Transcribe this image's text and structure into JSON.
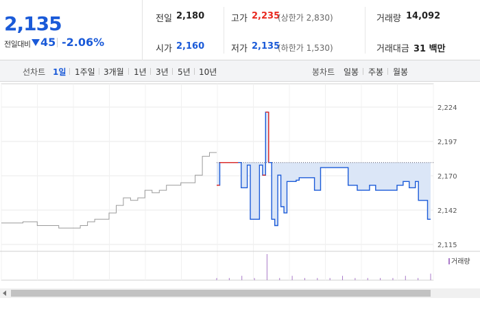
{
  "summary": {
    "current_price": "2,135",
    "change_label": "전일대비",
    "change_amount": "45",
    "change_percent": "-2.06%",
    "prev_close_label": "전일",
    "prev_close": "2,180",
    "open_label": "시가",
    "open": "2,160",
    "high_label": "고가",
    "high": "2,235",
    "upper_limit": "(상한가 2,830)",
    "low_label": "저가",
    "low": "2,135",
    "lower_limit": "(하한가 1,530)",
    "volume_label": "거래량",
    "volume": "14,092",
    "amount_label": "거래대금",
    "amount": "31 백만"
  },
  "line_tabs": {
    "heading": "선차트",
    "items": [
      "1일",
      "1주일",
      "3개월",
      "1년",
      "3년",
      "5년",
      "10년"
    ],
    "active": "1일"
  },
  "candle_tabs": {
    "heading": "봉차트",
    "items": [
      "일봉",
      "주봉",
      "월봉"
    ]
  },
  "chart_data": {
    "type": "line",
    "y_ticks": [
      "2,224",
      "2,197",
      "2,170",
      "2,142",
      "2,115"
    ],
    "ylim": [
      2115,
      2224
    ],
    "reference_price": 2180,
    "previous_day_series": [
      2132,
      2132,
      2132,
      2133,
      2133,
      2130,
      2130,
      2130,
      2128,
      2128,
      2128,
      2130,
      2133,
      2135,
      2135,
      2140,
      2146,
      2152,
      2150,
      2152,
      2158,
      2156,
      2158,
      2162,
      2162,
      2164,
      2164,
      2170,
      2185,
      2188,
      2188
    ],
    "today_series": [
      2162,
      2180,
      2180,
      2180,
      2180,
      2180,
      2180,
      2180,
      2160,
      2160,
      2178,
      2135,
      2135,
      2135,
      2178,
      2170,
      2220,
      2180,
      2135,
      2130,
      2170,
      2145,
      2140,
      2165,
      2165,
      2165,
      2166,
      2168,
      2168,
      2168,
      2168,
      2168,
      2158,
      2158,
      2176,
      2176,
      2176,
      2176,
      2176,
      2176,
      2176,
      2176,
      2176,
      2162,
      2162,
      2162,
      2158,
      2158,
      2158,
      2158,
      2162,
      2162,
      2158,
      2158,
      2158,
      2158,
      2158,
      2158,
      2158,
      2162,
      2162,
      2165,
      2165,
      2160,
      2160,
      2165,
      2150,
      2150,
      2150,
      2135,
      2135
    ],
    "volume_spikes": [
      1,
      1,
      2,
      1,
      12,
      1,
      2,
      1,
      1,
      1,
      2,
      1,
      1,
      1,
      1,
      2,
      1,
      3
    ],
    "legend": "거래량",
    "colors": {
      "up": "#e8281e",
      "down": "#1a5ad8",
      "prev": "#9a9a9a",
      "fill": "#dbe6f7",
      "volume": "#a878c8"
    }
  }
}
